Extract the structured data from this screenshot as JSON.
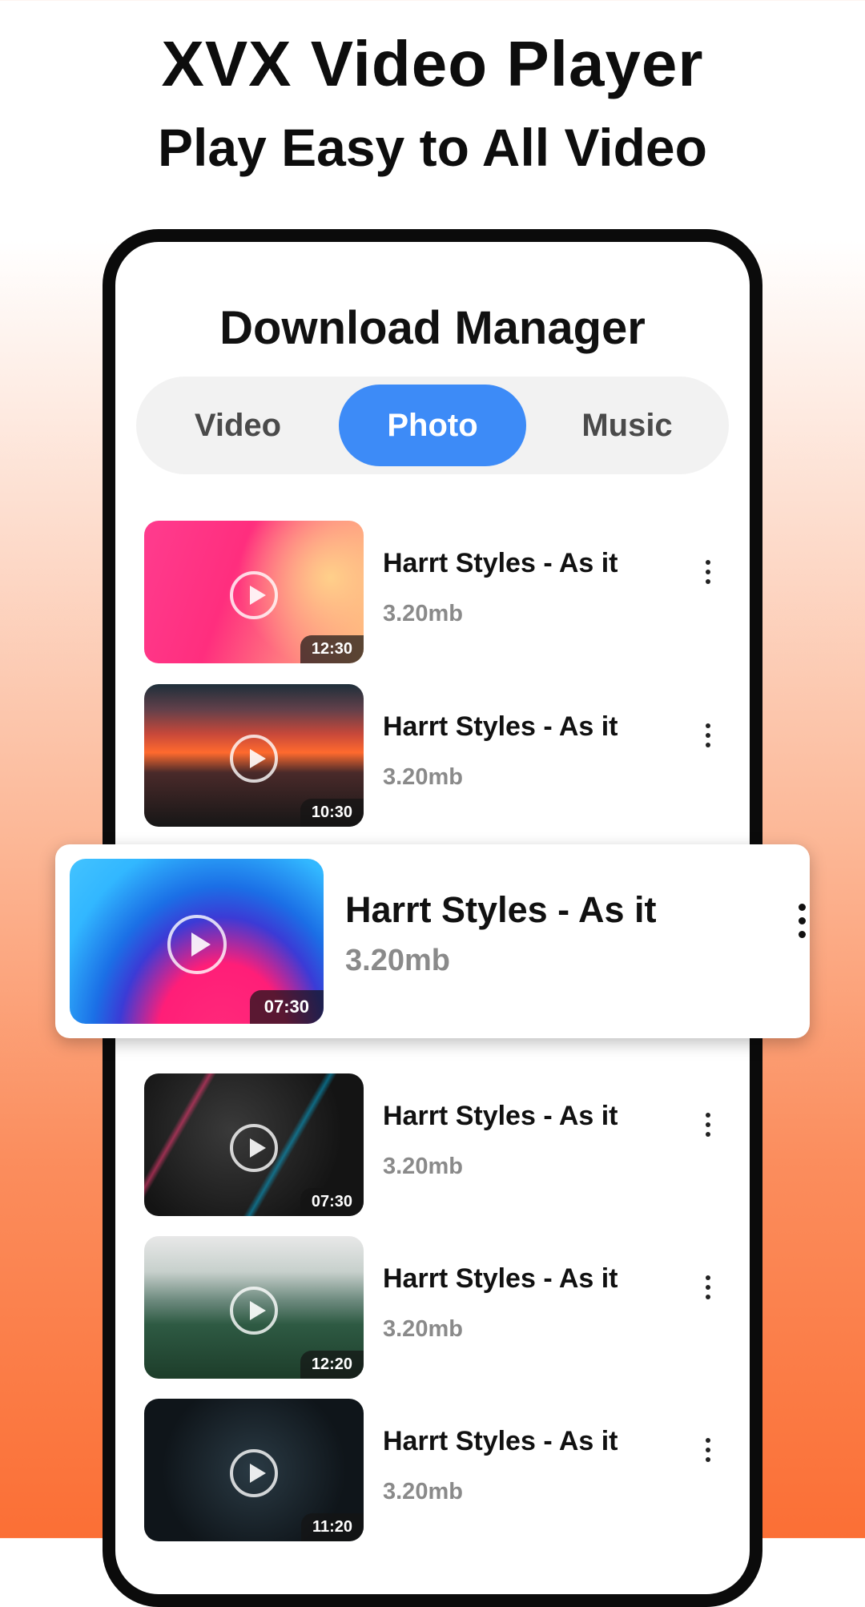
{
  "promo": {
    "title": "XVX Video Player",
    "subtitle": "Play Easy to All Video"
  },
  "screen": {
    "title": "Download Manager",
    "tabs": [
      {
        "label": "Video",
        "active": false
      },
      {
        "label": "Photo",
        "active": true
      },
      {
        "label": "Music",
        "active": false
      }
    ],
    "accent_color": "#3d8bf7"
  },
  "items": [
    {
      "title": "Harrt Styles - As it",
      "size": "3.20mb",
      "duration": "12:30"
    },
    {
      "title": "Harrt Styles - As it",
      "size": "3.20mb",
      "duration": "10:30"
    },
    {
      "title": "Harrt Styles - As it",
      "size": "3.20mb",
      "duration": "07:30",
      "highlighted": true
    },
    {
      "title": "Harrt Styles - As it",
      "size": "3.20mb",
      "duration": "07:30"
    },
    {
      "title": "Harrt Styles - As it",
      "size": "3.20mb",
      "duration": "12:20"
    },
    {
      "title": "Harrt Styles - As it",
      "size": "3.20mb",
      "duration": "11:20"
    }
  ],
  "icons": {
    "play": "play-circle-icon",
    "menu": "more-vertical-icon"
  }
}
